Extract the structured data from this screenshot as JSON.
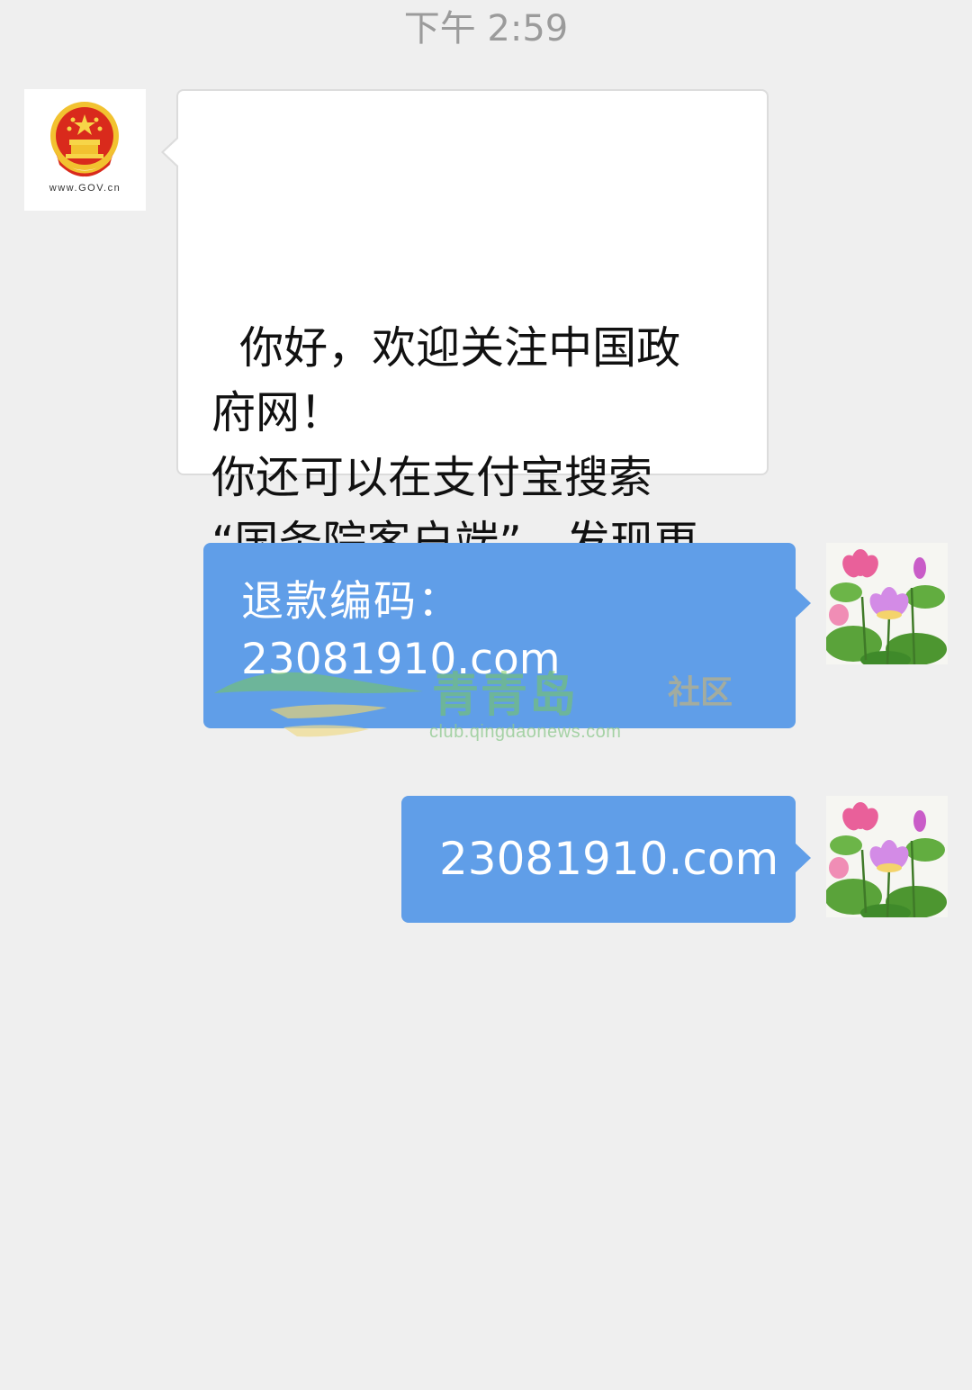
{
  "chat": {
    "timestamp": "下午 2:59",
    "messages": [
      {
        "sender": "official-account",
        "avatar_caption": "www.GOV.cn",
        "avatar_icon": "national-emblem-icon",
        "text": "你好，欢迎关注中国政\n府网！\n你还可以在支付宝搜索\n“国务院客户端”，发现更\n多服务。"
      },
      {
        "sender": "self",
        "avatar_icon": "lotus-avatar-icon",
        "line1": "退款编码：",
        "line2": "23081910.com"
      },
      {
        "sender": "self",
        "avatar_icon": "lotus-avatar-icon",
        "text": "23081910.com"
      }
    ]
  },
  "watermark": {
    "title": "青青岛",
    "subtitle": "社区",
    "url": "club.qingdaonews.com"
  },
  "colors": {
    "background": "#efefef",
    "outgoing_bubble": "#609ee8",
    "incoming_bubble": "#ffffff"
  }
}
